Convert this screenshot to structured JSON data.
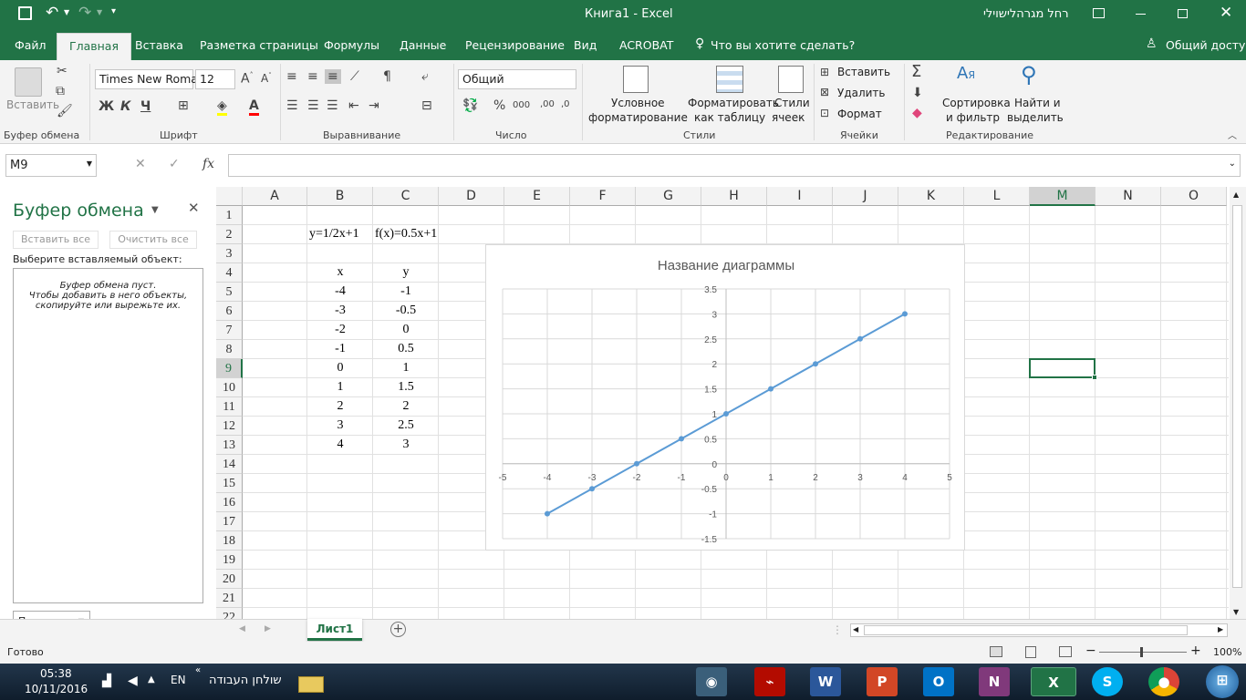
{
  "window": {
    "title": "Книга1  -  Excel",
    "user": "רחל מגרהלישוילי"
  },
  "ribbon_tabs": [
    "Файл",
    "Главная",
    "Вставка",
    "Разметка страницы",
    "Формулы",
    "Данные",
    "Рецензирование",
    "Вид",
    "ACROBAT"
  ],
  "tell_me": "Что вы хотите сделать?",
  "share": "Общий доступ",
  "ribbon": {
    "paste": "Вставить",
    "font_name": "Times New Roma",
    "font_size": "12",
    "bold": "Ж",
    "italic": "К",
    "underline": "Ч",
    "number_format": "Общий",
    "percent": "%",
    "thousands": "000",
    "cond_format": [
      "Условное",
      "форматирование"
    ],
    "format_table": [
      "Форматировать",
      "как таблицу"
    ],
    "cell_styles": [
      "Стили",
      "ячеек"
    ],
    "insert": "Вставить",
    "delete": "Удалить",
    "format": "Формат",
    "sort": [
      "Сортировка",
      "и фильтр"
    ],
    "find": [
      "Найти и",
      "выделить"
    ],
    "groups": [
      "Буфер обмена",
      "Шрифт",
      "Выравнивание",
      "Число",
      "Стили",
      "Ячейки",
      "Редактирование"
    ]
  },
  "formula_bar": {
    "name_box": "M9",
    "fx": "fx",
    "value": ""
  },
  "clipboard_panel": {
    "title": "Буфер обмена",
    "paste_all": "Вставить все",
    "clear_all": "Очистить все",
    "select_label": "Выберите вставляемый объект:",
    "empty_lines": [
      "Буфер обмена пуст.",
      "Чтобы добавить в него объекты,",
      "скопируйте или вырежьте их."
    ],
    "options": "Параметры"
  },
  "columns": [
    "A",
    "B",
    "C",
    "D",
    "E",
    "F",
    "G",
    "H",
    "I",
    "J",
    "K",
    "L",
    "M",
    "N",
    "O"
  ],
  "rows": [
    "1",
    "2",
    "3",
    "4",
    "5",
    "6",
    "7",
    "8",
    "9",
    "10",
    "11",
    "12",
    "13",
    "14",
    "15",
    "16",
    "17",
    "18",
    "19",
    "20",
    "21",
    "22"
  ],
  "cells": {
    "B2": "y=1/2x+1",
    "C2": "f(x)=0.5x+1",
    "B4": "x",
    "C4": "y",
    "B5": "-4",
    "C5": "-1",
    "B6": "-3",
    "C6": "-0.5",
    "B7": "-2",
    "C7": "0",
    "B8": "-1",
    "C8": "0.5",
    "B9": "0",
    "C9": "1",
    "B10": "1",
    "C10": "1.5",
    "B11": "2",
    "C11": "2",
    "B12": "3",
    "C12": "2.5",
    "B13": "4",
    "C13": "3"
  },
  "chart_data": {
    "type": "scatter",
    "title": "Название диаграммы",
    "x": [
      -4,
      -3,
      -2,
      -1,
      0,
      1,
      2,
      3,
      4
    ],
    "series": [
      {
        "values": [
          -1,
          -0.5,
          0,
          0.5,
          1,
          1.5,
          2,
          2.5,
          3
        ]
      }
    ],
    "xlim": [
      -5,
      5
    ],
    "ylim": [
      -1.5,
      3.5
    ],
    "x_ticks": [
      "-5",
      "-4",
      "-3",
      "-2",
      "-1",
      "0",
      "1",
      "2",
      "3",
      "4",
      "5"
    ],
    "y_ticks": [
      "-1.5",
      "-1",
      "-0.5",
      "0",
      "0.5",
      "1",
      "1.5",
      "2",
      "2.5",
      "3",
      "3.5"
    ],
    "grid": true,
    "color": "#5b9bd5"
  },
  "sheet_tab": "Лист1",
  "status": {
    "ready": "Готово",
    "zoom": "100%"
  },
  "taskbar": {
    "time": "05:38",
    "date": "10/11/2016",
    "lang": "EN",
    "desktop": "שולחן העבודה"
  },
  "colors": {
    "excel_green": "#217346",
    "series": "#5b9bd5"
  }
}
